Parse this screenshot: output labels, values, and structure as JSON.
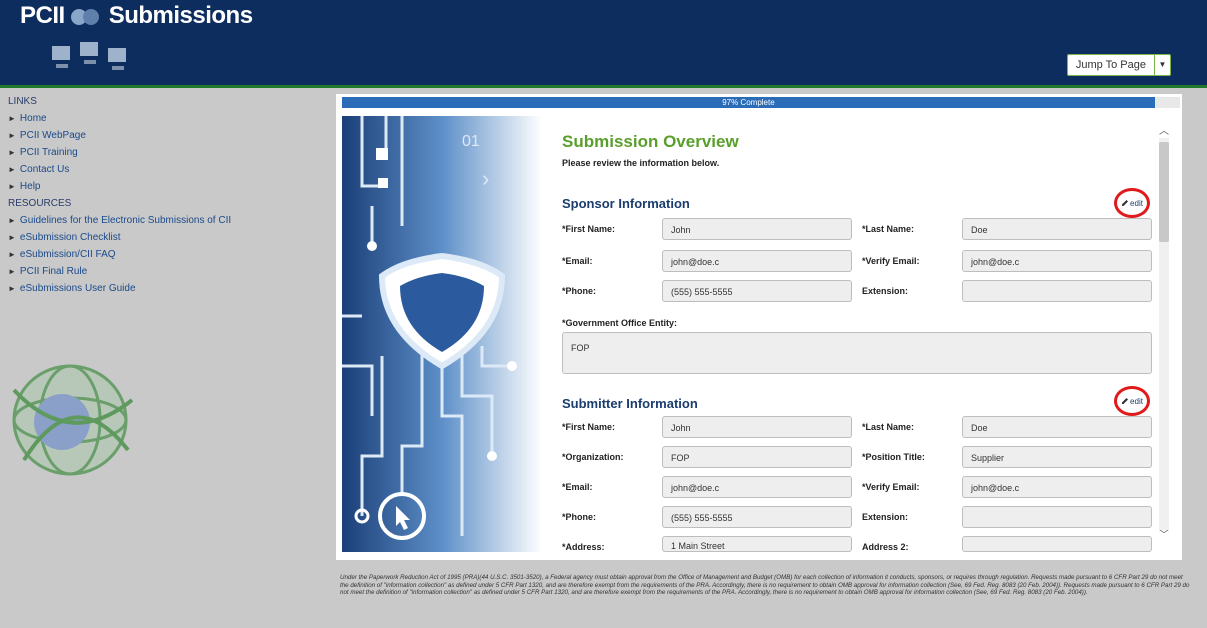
{
  "header": {
    "logo_prefix": "PCII",
    "logo_suffix": "Submissions",
    "jump_label": "Jump To Page"
  },
  "sidebar": {
    "links_title": "LINKS",
    "links": [
      {
        "label": "Home"
      },
      {
        "label": "PCII WebPage"
      },
      {
        "label": "PCII Training"
      },
      {
        "label": "Contact Us"
      },
      {
        "label": "Help"
      }
    ],
    "resources_title": "RESOURCES",
    "resources": [
      {
        "label": "Guidelines for the Electronic Submissions of CII"
      },
      {
        "label": "eSubmission Checklist"
      },
      {
        "label": "eSubmission/CII FAQ"
      },
      {
        "label": "PCII Final Rule"
      },
      {
        "label": "eSubmissions User Guide"
      }
    ]
  },
  "progress": {
    "label": "97% Complete",
    "percent": 97
  },
  "overview": {
    "title": "Submission Overview",
    "subtitle": "Please review the information below.",
    "edit_label": "edit"
  },
  "sponsor": {
    "heading": "Sponsor Information",
    "first_name_label": "*First Name:",
    "first_name": "John",
    "last_name_label": "*Last Name:",
    "last_name": "Doe",
    "email_label": "*Email:",
    "email": "john@doe.c",
    "verify_email_label": "*Verify Email:",
    "verify_email": "john@doe.c",
    "phone_label": "*Phone:",
    "phone": "(555) 555-5555",
    "extension_label": "Extension:",
    "extension": "",
    "gov_entity_label": "*Government Office Entity:",
    "gov_entity": "FOP"
  },
  "submitter": {
    "heading": "Submitter Information",
    "first_name_label": "*First Name:",
    "first_name": "John",
    "last_name_label": "*Last Name:",
    "last_name": "Doe",
    "org_label": "*Organization:",
    "org": "FOP",
    "position_label": "*Position Title:",
    "position": "Supplier",
    "email_label": "*Email:",
    "email": "john@doe.c",
    "verify_email_label": "*Verify Email:",
    "verify_email": "john@doe.c",
    "phone_label": "*Phone:",
    "phone": "(555) 555-5555",
    "extension_label": "Extension:",
    "extension": "",
    "address_label": "*Address:",
    "address": "1 Main Street",
    "address2_label": "Address 2:",
    "address2": ""
  },
  "footnote": "Under the Paperwork Reduction Act of 1995 (PRA)(44 U.S.C. 3501-3520), a Federal agency must obtain approval from the Office of Management and Budget (OMB) for each collection of information it conducts, sponsors, or requires through regulation. Requests made pursuant to 6 CFR Part 29 do not meet the definition of \"information collection\" as defined under 5 CFR Part 1320, and are therefore exempt from the requirements of the PRA. Accordingly, there is no requirement to obtain OMB approval for information collection (See, 69 Fed. Reg. 8083 (20 Feb. 2004)). Requests made pursuant to 6 CFR Part 29 do not meet the definition of \"information collection\" as defined under 5 CFR Part 1320, and are therefore exempt from the requirements of the PRA. Accordingly, there is no requirement to obtain OMB approval for information collection (See, 69 Fed. Reg. 8083 (20 Feb. 2004)).",
  "colors": {
    "header_bg": "#0e2d5f",
    "accent_green": "#5a9e2c",
    "progress_blue": "#2a6cb8",
    "highlight_red": "#e0191b"
  }
}
